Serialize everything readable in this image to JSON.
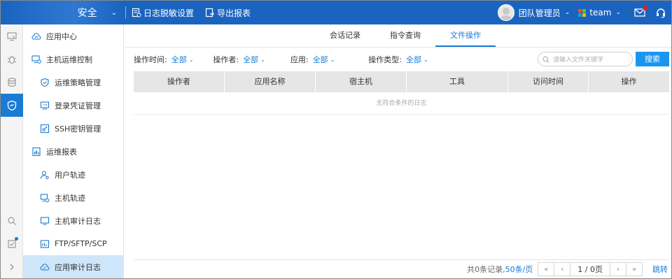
{
  "topbar": {
    "title": "安全",
    "actions": [
      {
        "label": "日志脱敏设置",
        "icon": "log-settings-icon"
      },
      {
        "label": "导出报表",
        "icon": "export-report-icon"
      }
    ],
    "user": {
      "name": "团队管理员"
    },
    "team": {
      "name": "team"
    },
    "icons": [
      "mail-icon",
      "headset-icon"
    ]
  },
  "rail": {
    "items": [
      "monitor-icon",
      "bug-icon",
      "database-icon",
      "shield-icon"
    ],
    "bottom": [
      "search-icon",
      "tasks-icon",
      "expand-icon"
    ]
  },
  "sidebar": {
    "items": [
      {
        "label": "应用中心",
        "level": "top",
        "icon": "cloud-app-icon"
      },
      {
        "label": "主机运维控制",
        "level": "top",
        "icon": "host-control-icon"
      },
      {
        "label": "运维策略管理",
        "level": "sub",
        "icon": "shield-check-icon"
      },
      {
        "label": "登录凭证管理",
        "level": "sub",
        "icon": "credential-icon"
      },
      {
        "label": "SSH密钥管理",
        "level": "sub",
        "icon": "key-icon"
      },
      {
        "label": "运维报表",
        "level": "top",
        "icon": "report-icon"
      },
      {
        "label": "用户轨迹",
        "level": "sub",
        "icon": "user-track-icon"
      },
      {
        "label": "主机轨迹",
        "level": "sub",
        "icon": "host-track-icon"
      },
      {
        "label": "主机审计日志",
        "level": "sub",
        "icon": "host-audit-icon"
      },
      {
        "label": "FTP/SFTP/SCP",
        "level": "sub",
        "icon": "ftp-icon"
      },
      {
        "label": "应用审计日志",
        "level": "sub",
        "icon": "app-audit-icon",
        "active": true
      }
    ]
  },
  "tabs": [
    {
      "label": "会话记录",
      "active": false
    },
    {
      "label": "指令查询",
      "active": false
    },
    {
      "label": "文件操作",
      "active": true
    }
  ],
  "filters": [
    {
      "label": "操作时间:",
      "value": "全部"
    },
    {
      "label": "操作者:",
      "value": "全部"
    },
    {
      "label": "应用:",
      "value": "全部"
    },
    {
      "label": "操作类型:",
      "value": "全部"
    }
  ],
  "search": {
    "placeholder": "请输入文件关键字",
    "button": "搜索"
  },
  "table": {
    "columns": [
      "操作者",
      "应用名称",
      "宿主机",
      "工具",
      "访问时间",
      "操作"
    ],
    "empty_text": "无符合条件的日志"
  },
  "pager": {
    "total": "共0条记录,",
    "per_page": "50条/页",
    "page_info": "1 / 0页",
    "jump": "跳转"
  },
  "colors": {
    "primary": "#1a64c0",
    "accent": "#1a7bd4",
    "button": "#1a96f0",
    "active_bg": "#cfe5fa"
  }
}
